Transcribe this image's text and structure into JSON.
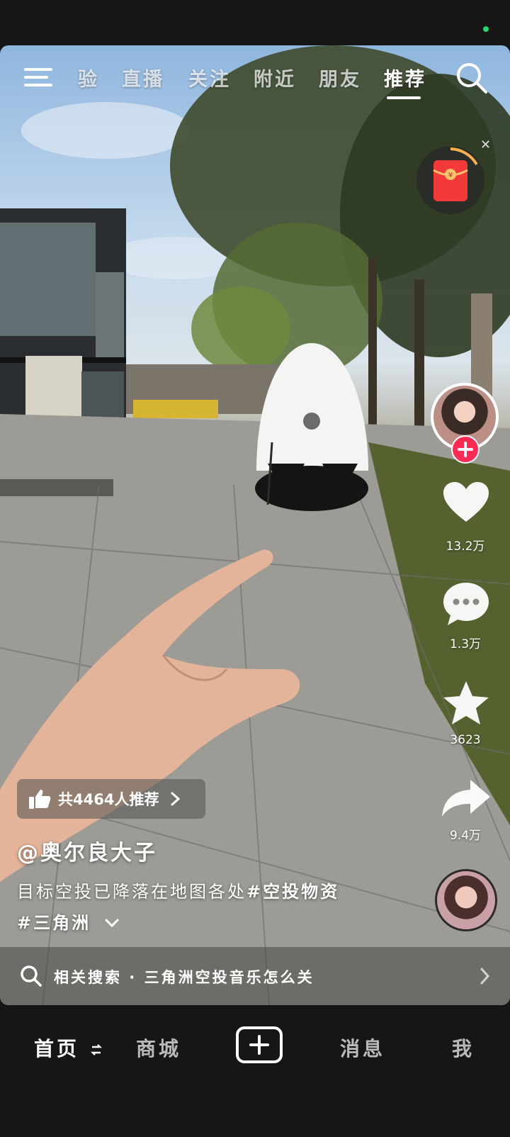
{
  "top_tabs": {
    "items": [
      {
        "label": "验",
        "active": false
      },
      {
        "label": "直播",
        "active": false
      },
      {
        "label": "关注",
        "active": false
      },
      {
        "label": "附近",
        "active": false
      },
      {
        "label": "朋友",
        "active": false
      },
      {
        "label": "推荐",
        "active": true
      }
    ]
  },
  "right_rail": {
    "like_count": "13.2万",
    "comment_count": "1.3万",
    "favorite_count": "3623",
    "share_count": "9.4万"
  },
  "recommend_badge": {
    "text": "共4464人推荐"
  },
  "post": {
    "author": "@奥尔良大子",
    "caption_text": "目标空投已降落在地图各处",
    "hashtag_1": "#空投物资",
    "hashtag_2": "#三角洲"
  },
  "related_search": {
    "text": "相关搜索 · 三角洲空投音乐怎么关"
  },
  "bottom_nav": {
    "home": "首页",
    "mall": "商城",
    "messages": "消息",
    "me": "我"
  },
  "colors": {
    "accent_red": "#fe2c55",
    "status_green": "#2ad46a"
  }
}
